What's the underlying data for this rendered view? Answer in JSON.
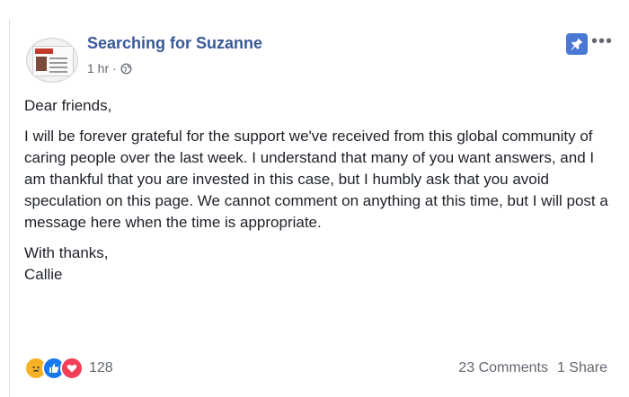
{
  "post": {
    "page_name": "Searching for Suzanne",
    "time": "1 hr",
    "separator": "·",
    "privacy_icon": "globe-icon",
    "pin_icon": "pin-icon",
    "more_icon": "more-options-icon",
    "accent_color": "#385898",
    "paragraphs": [
      "Dear friends,",
      "I will be forever grateful for the support we've received from this global community of caring people over the last week. I understand that many of you want answers, and I am thankful that you are invested in this case, but I humbly ask that you avoid speculation on this page. We cannot comment on anything at this time, but I will post a message here when the time is appropriate.",
      "With thanks,\nCallie"
    ]
  },
  "footer": {
    "reaction_icons": [
      "sad-reaction-icon",
      "like-reaction-icon",
      "love-reaction-icon"
    ],
    "reaction_count": "128",
    "comments": "23 Comments",
    "shares": "1 Share"
  }
}
